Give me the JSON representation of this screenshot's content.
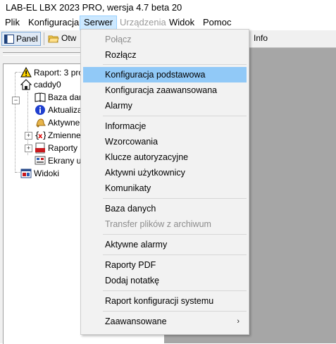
{
  "window": {
    "title": "LAB-EL LBX 2023 PRO, wersja 4.7 beta 20"
  },
  "menubar": {
    "items": [
      {
        "label": "Plik"
      },
      {
        "label": "Konfiguracja"
      },
      {
        "label": "Serwer"
      },
      {
        "label": "Urządzenia"
      },
      {
        "label": "Widok"
      },
      {
        "label": "Pomoc"
      }
    ]
  },
  "toolbar": {
    "panel_label": "Panel",
    "open_label": "Otw",
    "info_label": "Info"
  },
  "tree": {
    "items": [
      {
        "label": "Raport: 3 pro",
        "icon": "warning-icon"
      },
      {
        "label": "caddy0",
        "icon": "home-icon"
      },
      {
        "label": "Baza dan",
        "icon": "book-icon"
      },
      {
        "label": "Aktualizac",
        "icon": "info-icon"
      },
      {
        "label": "Aktywne",
        "icon": "bell-icon"
      },
      {
        "label": "Zmienne",
        "icon": "variables-icon"
      },
      {
        "label": "Raporty P",
        "icon": "pdf-icon"
      },
      {
        "label": "Ekrany uż",
        "icon": "screen-icon"
      },
      {
        "label": "Widoki",
        "icon": "views-icon"
      }
    ]
  },
  "server_menu": {
    "items": [
      {
        "label": "Połącz",
        "disabled": true
      },
      {
        "label": "Rozłącz"
      },
      {
        "label": "Konfiguracja podstawowa",
        "highlighted": true
      },
      {
        "label": "Konfiguracja zaawansowana"
      },
      {
        "label": "Alarmy"
      },
      {
        "label": "Informacje"
      },
      {
        "label": "Wzorcowania"
      },
      {
        "label": "Klucze autoryzacyjne"
      },
      {
        "label": "Aktywni użytkownicy"
      },
      {
        "label": "Komunikaty"
      },
      {
        "label": "Baza danych"
      },
      {
        "label": "Transfer plików z archiwum",
        "disabled": true
      },
      {
        "label": "Aktywne alarmy"
      },
      {
        "label": "Raporty PDF"
      },
      {
        "label": "Dodaj notatkę"
      },
      {
        "label": "Raport konfiguracji systemu"
      },
      {
        "label": "Zaawansowane",
        "has_submenu": true
      }
    ],
    "submenu_arrow": "›"
  },
  "colors": {
    "highlight": "#91c9f7",
    "menu_active": "#cce8ff",
    "workspace": "#a6a6a6"
  }
}
